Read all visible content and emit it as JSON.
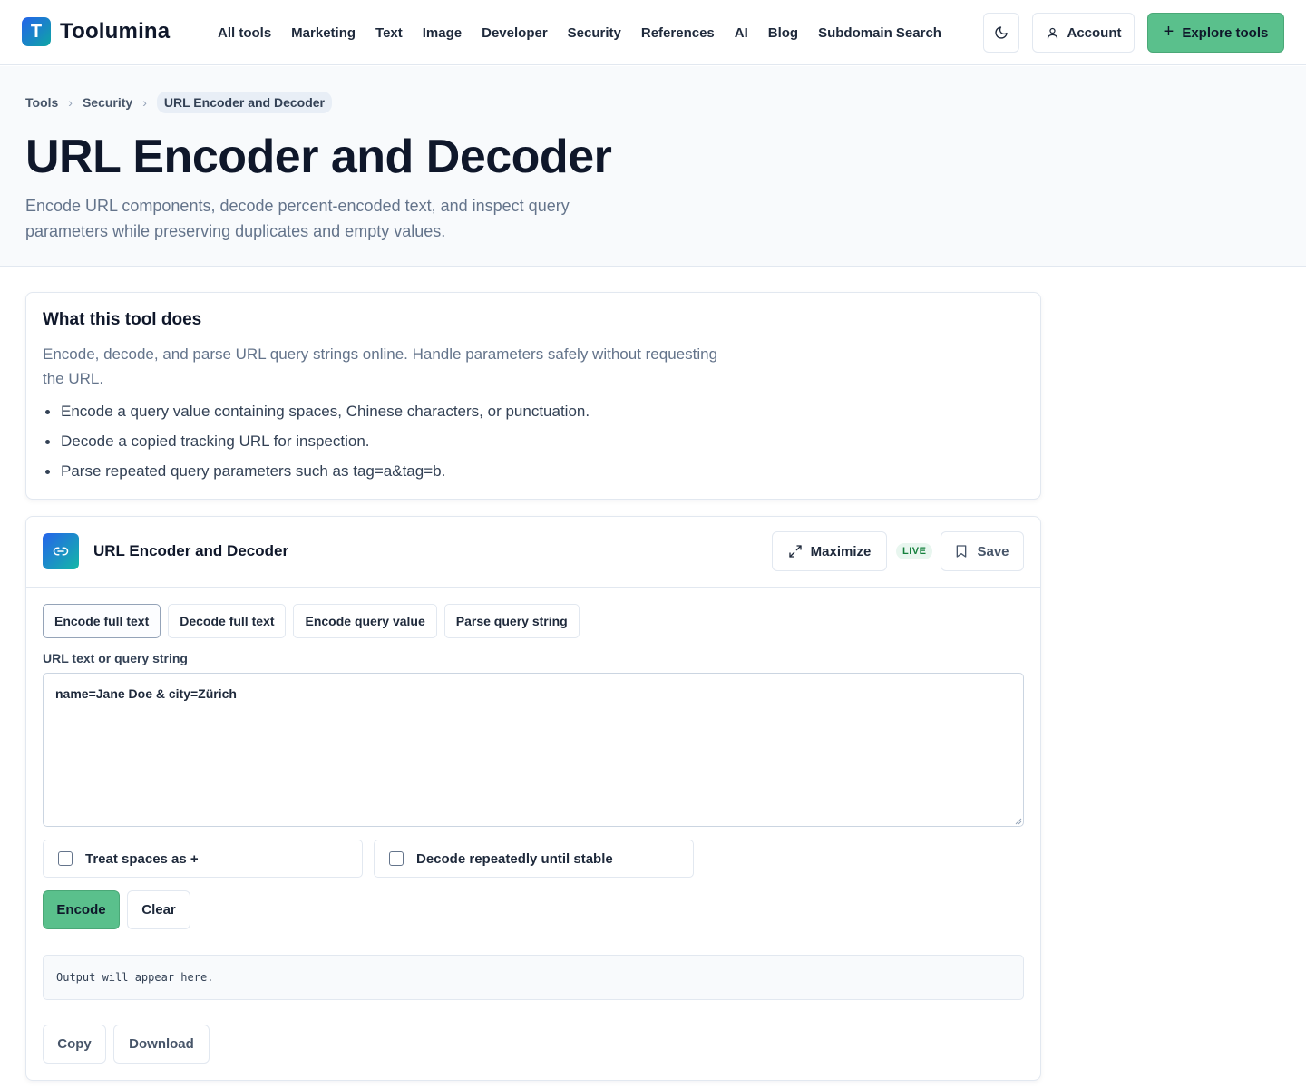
{
  "brand": {
    "logo_letter": "T",
    "name": "Toolumina"
  },
  "nav": [
    {
      "label": "All tools"
    },
    {
      "label": "Marketing"
    },
    {
      "label": "Text"
    },
    {
      "label": "Image"
    },
    {
      "label": "Developer"
    },
    {
      "label": "Security"
    },
    {
      "label": "References"
    },
    {
      "label": "AI"
    },
    {
      "label": "Blog"
    },
    {
      "label": "Subdomain Search"
    }
  ],
  "header": {
    "theme_icon": "moon-icon",
    "account_label": "Account",
    "account_icon": "user-icon",
    "explore_label": "Explore tools",
    "explore_icon": "plus-icon"
  },
  "breadcrumb": {
    "items": [
      "Tools",
      "Security"
    ],
    "current": "URL Encoder and Decoder"
  },
  "page": {
    "title": "URL Encoder and Decoder",
    "subtitle": "Encode URL components, decode percent-encoded text, and inspect query parameters while preserving duplicates and empty values."
  },
  "info": {
    "title": "What this tool does",
    "description": "Encode, decode, and parse URL query strings online. Handle parameters safely without requesting the URL.",
    "bullets": [
      "Encode a query value containing spaces, Chinese characters, or punctuation.",
      "Decode a copied tracking URL for inspection.",
      "Parse repeated query parameters such as tag=a&tag=b."
    ]
  },
  "tool": {
    "icon": "link-icon",
    "name": "URL Encoder and Decoder",
    "maximize_label": "Maximize",
    "maximize_icon": "expand-icon",
    "live_badge": "LIVE",
    "save_label": "Save",
    "save_icon": "bookmark-icon",
    "modes": [
      "Encode full text",
      "Decode full text",
      "Encode query value",
      "Parse query string"
    ],
    "active_mode": "Encode full text",
    "input_label": "URL text or query string",
    "input_value": "name=Jane Doe & city=Zürich",
    "options": [
      {
        "label": "Treat spaces as +",
        "checked": false
      },
      {
        "label": "Decode repeatedly until stable",
        "checked": false
      }
    ],
    "encode_label": "Encode",
    "clear_label": "Clear",
    "output_placeholder": "Output will appear here.",
    "copy_label": "Copy",
    "download_label": "Download"
  },
  "colors": {
    "accent_green": "#5ac08c",
    "text_dark": "#0f172a",
    "muted": "#64748b",
    "border": "#e2e8f0",
    "hero_bg": "#f8fafc"
  }
}
